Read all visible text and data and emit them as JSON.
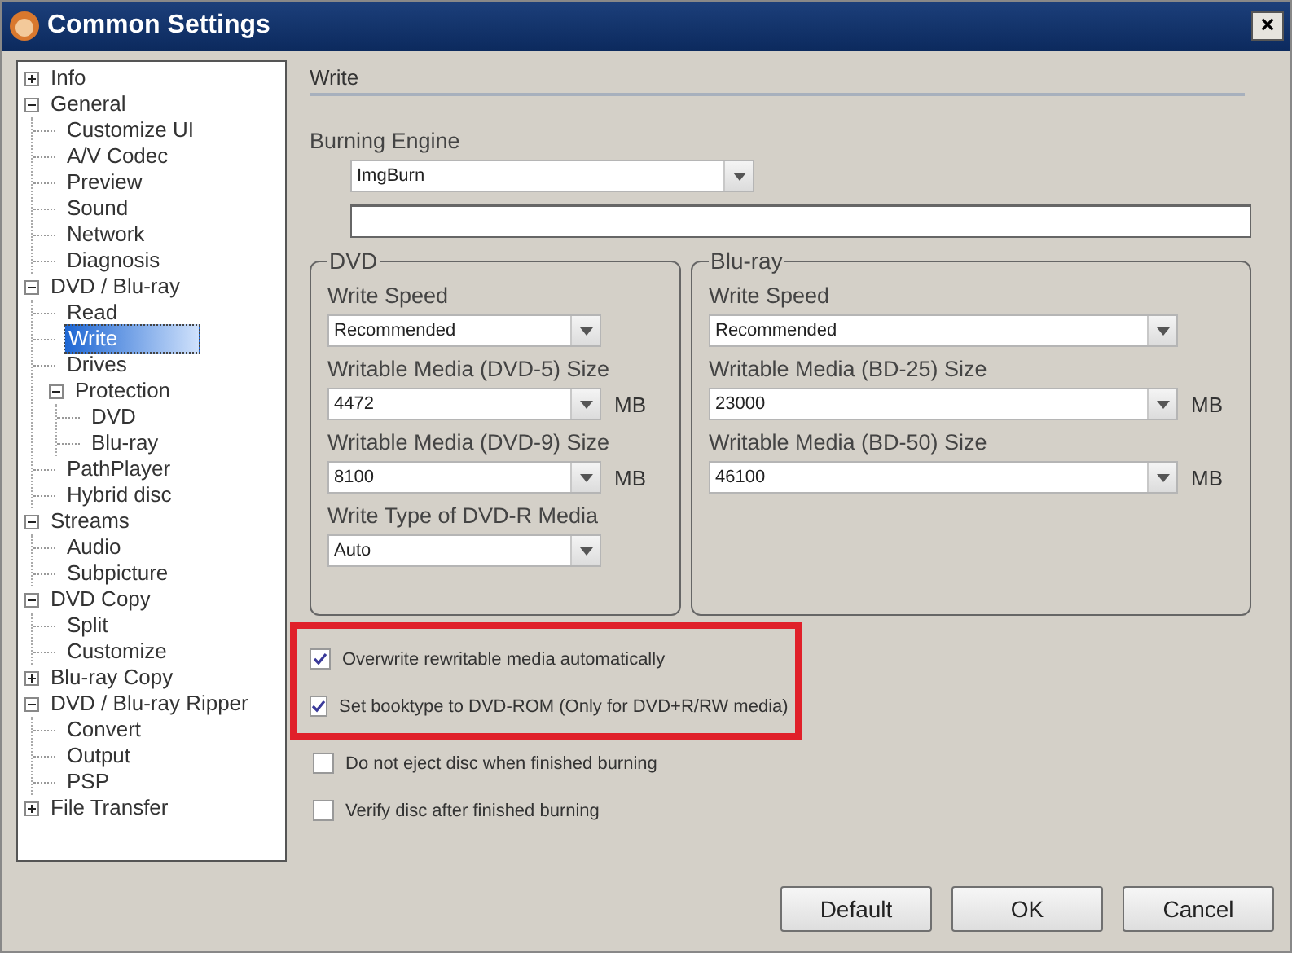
{
  "window": {
    "title": "Common Settings",
    "close": "×"
  },
  "tree": [
    {
      "label": "Info",
      "expanded": false,
      "selected": false
    },
    {
      "label": "General",
      "expanded": true,
      "selected": false,
      "children": [
        {
          "label": "Customize UI",
          "selected": false
        },
        {
          "label": "A/V Codec",
          "selected": false
        },
        {
          "label": "Preview",
          "selected": false
        },
        {
          "label": "Sound",
          "selected": false
        },
        {
          "label": "Network",
          "selected": false
        },
        {
          "label": "Diagnosis",
          "selected": false
        }
      ]
    },
    {
      "label": "DVD / Blu-ray",
      "expanded": true,
      "selected": false,
      "children": [
        {
          "label": "Read",
          "selected": false
        },
        {
          "label": "Write",
          "selected": true
        },
        {
          "label": "Drives",
          "selected": false
        },
        {
          "label": "Protection",
          "expanded": true,
          "selected": false,
          "children": [
            {
              "label": "DVD",
              "selected": false
            },
            {
              "label": "Blu-ray",
              "selected": false
            }
          ]
        },
        {
          "label": "PathPlayer",
          "selected": false
        },
        {
          "label": "Hybrid disc",
          "selected": false
        }
      ]
    },
    {
      "label": "Streams",
      "expanded": true,
      "selected": false,
      "children": [
        {
          "label": "Audio",
          "selected": false
        },
        {
          "label": "Subpicture",
          "selected": false
        }
      ]
    },
    {
      "label": "DVD Copy",
      "expanded": true,
      "selected": false,
      "children": [
        {
          "label": "Split",
          "selected": false
        },
        {
          "label": "Customize",
          "selected": false
        }
      ]
    },
    {
      "label": "Blu-ray Copy",
      "expanded": false,
      "selected": false
    },
    {
      "label": "DVD / Blu-ray Ripper",
      "expanded": true,
      "selected": false,
      "children": [
        {
          "label": "Convert",
          "selected": false
        },
        {
          "label": "Output",
          "selected": false
        },
        {
          "label": "PSP",
          "selected": false
        }
      ]
    },
    {
      "label": "File Transfer",
      "expanded": false,
      "selected": false
    }
  ],
  "section_title": "Write",
  "burning_engine": {
    "label": "Burning Engine",
    "value": "ImgBurn"
  },
  "groups": [
    {
      "title": "DVD",
      "fields": [
        {
          "label": "Write Speed",
          "value": "Recommended"
        },
        {
          "label": "Writable Media (DVD-5) Size",
          "value": "4472",
          "unit": "MB"
        },
        {
          "label": "Writable Media (DVD-9) Size",
          "value": "8100",
          "unit": "MB"
        },
        {
          "label": "Write Type of DVD-R Media",
          "value": "Auto"
        }
      ]
    },
    {
      "title": "Blu-ray",
      "fields": [
        {
          "label": "Write Speed",
          "value": "Recommended"
        },
        {
          "label": "Writable Media (BD-25) Size",
          "value": "23000",
          "unit": "MB"
        },
        {
          "label": "Writable Media (BD-50) Size",
          "value": "46100",
          "unit": "MB"
        }
      ]
    }
  ],
  "options": [
    {
      "label": "Overwrite rewritable media automatically",
      "checked": true,
      "highlighted": true
    },
    {
      "label": "Set booktype to DVD-ROM (Only for DVD+R/RW media)",
      "checked": true,
      "highlighted": true
    },
    {
      "label": "Do not eject disc when finished burning",
      "checked": false,
      "highlighted": false
    },
    {
      "label": "Verify disc after finished burning",
      "checked": false,
      "highlighted": false
    }
  ],
  "buttons": [
    "Default",
    "OK",
    "Cancel"
  ]
}
